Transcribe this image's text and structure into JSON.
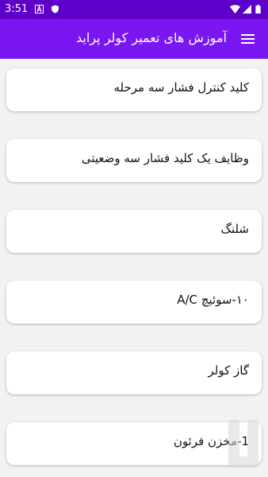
{
  "status_bar": {
    "time": "3:51",
    "left_icons": [
      "sim-a-icon",
      "shield-icon"
    ],
    "right_icons": [
      "wifi-icon",
      "signal-icon",
      "battery-icon"
    ]
  },
  "app_bar": {
    "title": "آموزش های تعمیر کولر پراید",
    "menu_icon": "hamburger-menu-icon",
    "color": "#7a16f2"
  },
  "list": {
    "items": [
      {
        "label": "کلید کنترل فشار سه مرحله"
      },
      {
        "label": "وظایف یک کلید فشار سه وضعیتی"
      },
      {
        "label": "شلنگ"
      },
      {
        "label": "۱۰-سوئیچ A/C"
      },
      {
        "label": "گاز کولر"
      },
      {
        "label": "1-مخزن فرئون"
      }
    ]
  },
  "watermark": {
    "icon": "bazaar-logo-icon"
  }
}
